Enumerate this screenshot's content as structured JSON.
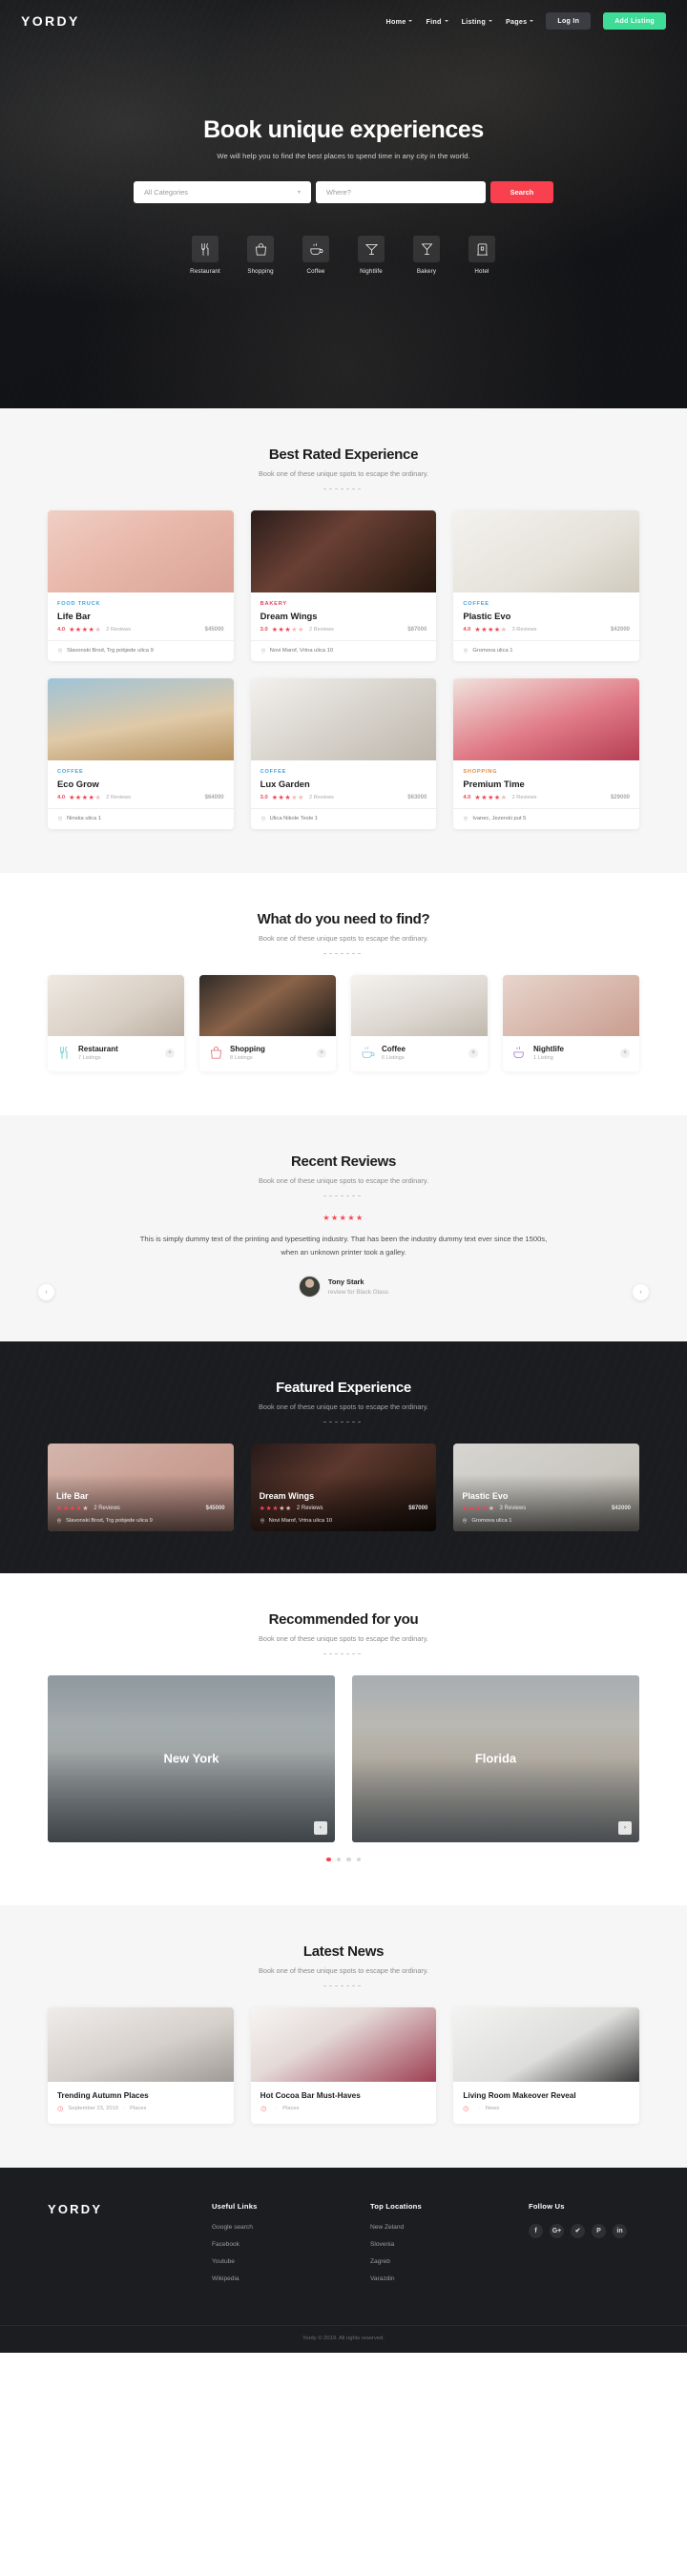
{
  "brand": "YORDY",
  "nav": {
    "links": [
      {
        "label": "Home",
        "has_caret": true
      },
      {
        "label": "Find",
        "has_caret": true
      },
      {
        "label": "Listing",
        "has_caret": true
      },
      {
        "label": "Pages",
        "has_caret": true
      }
    ],
    "login_label": "Log In",
    "add_listing_label": "Add Listing"
  },
  "hero": {
    "title": "Book unique experiences",
    "subtitle": "We will help you to find the best places to spend time in any city in the world.",
    "search": {
      "category_value": "All Categories",
      "where_placeholder": "Where?",
      "button_label": "Search"
    },
    "categories": [
      {
        "label": "Restaurant",
        "icon": "restaurant-icon"
      },
      {
        "label": "Shopping",
        "icon": "shopping-bag-icon"
      },
      {
        "label": "Coffee",
        "icon": "coffee-cup-icon"
      },
      {
        "label": "Nightlife",
        "icon": "martini-glass-icon"
      },
      {
        "label": "Bakery",
        "icon": "cocktail-glass-icon"
      },
      {
        "label": "Hotel",
        "icon": "hotel-icon"
      }
    ]
  },
  "best_rated": {
    "title": "Best Rated Experience",
    "subtitle": "Book one of these unique spots to escape the ordinary.",
    "cards": [
      {
        "category": "FOOD TRUCK",
        "category_color": "#3da5e0",
        "title": "Life Bar",
        "rating": "4.0",
        "stars": 4,
        "reviews": "2 Reviews",
        "price": "$45000",
        "address": "Slavonski Brod, Trg pobjede ulica 9",
        "art": "ph-a"
      },
      {
        "category": "BAKERY",
        "category_color": "#e8415a",
        "title": "Dream Wings",
        "rating": "3.0",
        "stars": 3,
        "reviews": "2 Reviews",
        "price": "$87000",
        "address": "Novi Marof, Vrtna ulica 10",
        "art": "ph-b"
      },
      {
        "category": "COFFEE",
        "category_color": "#3da5e0",
        "title": "Plastic Evo",
        "rating": "4.0",
        "stars": 4,
        "reviews": "3 Reviews",
        "price": "$42000",
        "address": "Gromova ulica 1",
        "art": "ph-c"
      },
      {
        "category": "COFFEE",
        "category_color": "#3da5e0",
        "title": "Eco Grow",
        "rating": "4.0",
        "stars": 4,
        "reviews": "2 Reviews",
        "price": "$64000",
        "address": "Ninska ulica 1",
        "art": "ph-d"
      },
      {
        "category": "COFFEE",
        "category_color": "#3da5e0",
        "title": "Lux Garden",
        "rating": "3.0",
        "stars": 3,
        "reviews": "2 Reviews",
        "price": "$63000",
        "address": "Ulica Nikole Tesle 1",
        "art": "ph-e"
      },
      {
        "category": "SHOPPING",
        "category_color": "#e08a3d",
        "title": "Premium Time",
        "rating": "4.0",
        "stars": 4,
        "reviews": "2 Reviews",
        "price": "$29000",
        "address": "Ivanec, Jezerski put 5",
        "art": "ph-f"
      }
    ]
  },
  "find": {
    "title": "What do you need to find?",
    "subtitle": "Book one of these unique spots to escape the ordinary.",
    "cards": [
      {
        "name": "Restaurant",
        "count": "7 Listings",
        "icon": "restaurant-icon",
        "color": "#4cc4c0",
        "art": "ph-g",
        "plus": "+"
      },
      {
        "name": "Shopping",
        "count": "8 Listings",
        "icon": "shopping-bag-icon",
        "color": "#e8626c",
        "art": "ph-h",
        "plus": "+"
      },
      {
        "name": "Coffee",
        "count": "6 Listings",
        "icon": "coffee-cup-icon",
        "color": "#7fc4e8",
        "art": "ph-i",
        "plus": "+"
      },
      {
        "name": "Nightlife",
        "count": "1 Listing",
        "icon": "martini-glass-icon",
        "color": "#a16fd0",
        "art": "ph-j",
        "plus": "+"
      }
    ]
  },
  "reviews": {
    "title": "Recent Reviews",
    "subtitle": "Book one of these unique spots to escape the ordinary.",
    "stars": "★★★★★",
    "text": "This is simply dummy text of the printing and typesetting industry. That has been the industry dummy text ever since the 1500s, when an unknown printer took a galley.",
    "author": "Tony Stark",
    "author_sub": "review for Black Glass",
    "prev": "‹",
    "next": "›"
  },
  "featured": {
    "title": "Featured Experience",
    "subtitle": "Book one of these unique spots to escape the ordinary.",
    "cards": [
      {
        "title": "Life Bar",
        "stars": 4,
        "reviews": "2 Reviews",
        "price": "$45000",
        "address": "Slavonski Brod, Trg pobjede ulica 9",
        "art": "ph-a"
      },
      {
        "title": "Dream Wings",
        "stars": 3,
        "reviews": "2 Reviews",
        "price": "$87000",
        "address": "Novi Marof, Vrtna ulica 10",
        "art": "ph-b"
      },
      {
        "title": "Plastic Evo",
        "stars": 4,
        "reviews": "3 Reviews",
        "price": "$42000",
        "address": "Gromova ulica 1",
        "art": "ph-c"
      }
    ]
  },
  "recommended": {
    "title": "Recommended for you",
    "subtitle": "Book one of these unique spots to escape the ordinary.",
    "cities": [
      {
        "name": "New York",
        "art": "ph-k",
        "arrow": "‹",
        "arrow_side": "left"
      },
      {
        "name": "Florida",
        "art": "ph-l",
        "arrow": "›",
        "arrow_side": "right"
      }
    ],
    "dots": 4,
    "active_dot": 0
  },
  "news": {
    "title": "Latest News",
    "subtitle": "Book one of these unique spots to escape the ordinary.",
    "items": [
      {
        "title": "Trending Autumn Places",
        "date": "September 23, 2019",
        "sep": "·",
        "tag": "Places",
        "art": "ph-m"
      },
      {
        "title": "Hot Cocoa Bar Must-Haves",
        "date": "",
        "sep": "·",
        "tag": "Places",
        "art": "ph-n"
      },
      {
        "title": "Living Room Makeover Reveal",
        "date": "",
        "sep": "·",
        "tag": "News",
        "art": "ph-o"
      }
    ]
  },
  "footer": {
    "logo": "YORDY",
    "useful_links": {
      "heading": "Useful Links",
      "items": [
        "Google search",
        "Facebook",
        "Youtube",
        "Wikipedia"
      ]
    },
    "top_locations": {
      "heading": "Top Locations",
      "items": [
        "New Zeland",
        "Slovenia",
        "Zagreb",
        "Varazdin"
      ]
    },
    "follow": {
      "heading": "Follow Us",
      "socials": [
        {
          "glyph": "f",
          "name": "facebook-icon"
        },
        {
          "glyph": "G+",
          "name": "google-plus-icon"
        },
        {
          "glyph": "✔",
          "name": "twitter-icon"
        },
        {
          "glyph": "P",
          "name": "pinterest-icon"
        },
        {
          "glyph": "in",
          "name": "linkedin-icon"
        }
      ]
    },
    "copyright": "Yordy © 2019. All rights reserved."
  }
}
